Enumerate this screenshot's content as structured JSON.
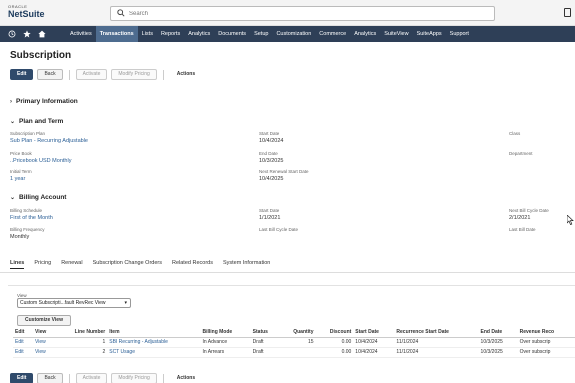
{
  "header": {
    "brand": "ORACLE",
    "product": "NetSuite",
    "search_placeholder": "Search"
  },
  "nav": {
    "icons": [
      "history-icon",
      "star-icon",
      "home-icon"
    ],
    "items": [
      {
        "label": "Activities",
        "active": false
      },
      {
        "label": "Transactions",
        "active": true
      },
      {
        "label": "Lists",
        "active": false
      },
      {
        "label": "Reports",
        "active": false
      },
      {
        "label": "Analytics",
        "active": false
      },
      {
        "label": "Documents",
        "active": false
      },
      {
        "label": "Setup",
        "active": false
      },
      {
        "label": "Customization",
        "active": false
      },
      {
        "label": "Commerce",
        "active": false
      },
      {
        "label": "Analytics",
        "active": false
      },
      {
        "label": "SuiteView",
        "active": false
      },
      {
        "label": "SuiteApps",
        "active": false
      },
      {
        "label": "Support",
        "active": false
      }
    ]
  },
  "page": {
    "title": "Subscription"
  },
  "toolbar": {
    "edit": "Edit",
    "back": "Back",
    "activate": "Activate",
    "modify_pricing": "Modify Pricing",
    "actions": "Actions"
  },
  "sections": {
    "primary": "Primary Information",
    "plan": "Plan and Term",
    "billing": "Billing Account"
  },
  "plan_fields": {
    "subscription_plan_label": "Subscription Plan",
    "subscription_plan_value": "Sub Plan - Recurring Adjustable",
    "price_book_label": "Price Book",
    "price_book_value": "..Pricebook USD Monthly",
    "initial_term_label": "Initial Term",
    "initial_term_value": "1 year",
    "start_date_label": "Start Date",
    "start_date_value": "10/4/2024",
    "end_date_label": "End Date",
    "end_date_value": "10/3/2025",
    "next_renewal_label": "Next Renewal Start Date",
    "next_renewal_value": "10/4/2025",
    "class_label": "Class",
    "department_label": "Department"
  },
  "billing_fields": {
    "billing_schedule_label": "Billing Schedule",
    "billing_schedule_value": "First of the Month",
    "billing_frequency_label": "Billing Frequency",
    "billing_frequency_value": "Monthly",
    "start_date_label": "Start Date",
    "start_date_value": "1/1/2021",
    "last_bill_cycle_label": "Last Bill Cycle Date",
    "next_bill_cycle_label": "Next Bill Cycle Date",
    "next_bill_cycle_value": "2/1/2021",
    "last_bill_date_label": "Last Bill Date"
  },
  "tabs": [
    {
      "label": "Lines",
      "active": true
    },
    {
      "label": "Pricing",
      "active": false
    },
    {
      "label": "Renewal",
      "active": false
    },
    {
      "label": "Subscription Change Orders",
      "active": false
    },
    {
      "label": "Related Records",
      "active": false
    },
    {
      "label": "System Information",
      "active": false
    }
  ],
  "lines": {
    "view_label": "View",
    "view_value": "Custom Subscripti...fault RevRec View",
    "customize_button": "Customize View",
    "columns": [
      "Edit",
      "View",
      "Line Number",
      "Item",
      "Billing Mode",
      "Status",
      "Quantity",
      "Discount",
      "Start Date",
      "Recurrence Start Date",
      "End Date",
      "Revenue Reco"
    ],
    "rows": [
      [
        "Edit",
        "View",
        "1",
        "SBI Recurring - Adjustable",
        "In Advance",
        "Draft",
        "15",
        "0.00",
        "10/4/2024",
        "11/1/2024",
        "10/3/2025",
        "Over subscrip"
      ],
      [
        "Edit",
        "View",
        "2",
        "SCT Usage",
        "In Arrears",
        "Draft",
        "",
        "0.00",
        "10/4/2024",
        "11/1/2024",
        "10/3/2025",
        "Over subscrip"
      ]
    ]
  }
}
